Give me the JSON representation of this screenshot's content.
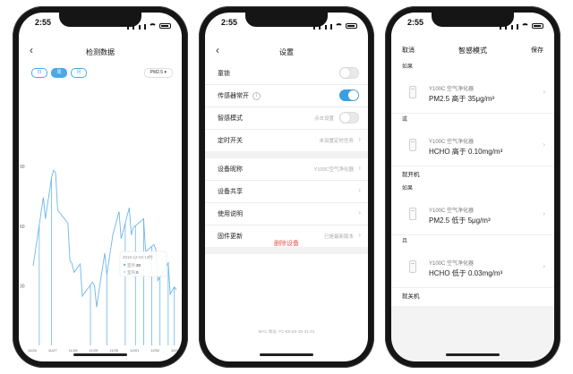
{
  "screens": [
    {
      "time": "2:55",
      "title": "检测数据",
      "segments": [
        "日",
        "周",
        "月"
      ],
      "active_segment": 1,
      "pm_select": "PM2.5 ▾",
      "y_ticks": [
        "90",
        "60",
        "30"
      ],
      "x_ticks": [
        "11/26",
        "11/27",
        "11/28",
        "11/29",
        "11/30",
        "12/01",
        "12/02",
        "12/03"
      ],
      "tooltip": {
        "date": "2019-12-03 13时",
        "outdoor_label": "室外",
        "outdoor_value": "30",
        "indoor_label": "室内",
        "indoor_value": "0"
      }
    },
    {
      "time": "2:55",
      "title": "设置",
      "rows": [
        {
          "label": "童锁",
          "toggle": "off"
        },
        {
          "label": "传感器常开",
          "info": "i",
          "toggle": "on"
        },
        {
          "label": "智感模式",
          "value": "点击设置",
          "toggle": "off"
        },
        {
          "label": "定时开关",
          "value": "未设置定时任务"
        }
      ],
      "rows2": [
        {
          "label": "设备昵称",
          "value": "Y100C空气净化器"
        },
        {
          "label": "设备共享",
          "value": ""
        },
        {
          "label": "使用说明",
          "value": ""
        },
        {
          "label": "固件更新",
          "value": "已是最新版本"
        }
      ],
      "delete_label": "删除设备",
      "mac": "MAC 地址: FC-E6-E6-1E-31-01"
    },
    {
      "time": "2:55",
      "title": "智感模式",
      "cancel": "取消",
      "save": "保存",
      "if_label": "如果",
      "or_label": "或",
      "and_label": "且",
      "turn_on": "就开机",
      "turn_off": "就关机",
      "device_name": "Y100C 空气净化器",
      "cond1": "PM2.5 高于 35μg/m³",
      "cond2": "HCHO 高于 0.10mg/m³",
      "cond3": "PM2.5 低于 5μg/m³",
      "cond4": "HCHO 低于 0.03mg/m³"
    }
  ],
  "chart_data": {
    "type": "line",
    "title": "",
    "xlabel": "",
    "ylabel": "",
    "x": [
      "11/26",
      "11/27",
      "11/28",
      "11/29",
      "11/30",
      "12/01",
      "12/02",
      "12/03"
    ],
    "ylim": [
      0,
      100
    ],
    "series": [
      {
        "name": "室外",
        "values": [
          48,
          85,
          40,
          22,
          58,
          65,
          42,
          28
        ],
        "color": "#6cb7ea"
      }
    ],
    "grid": false
  },
  "colors": {
    "accent": "#4aa8e6",
    "danger": "#e65a4f"
  }
}
